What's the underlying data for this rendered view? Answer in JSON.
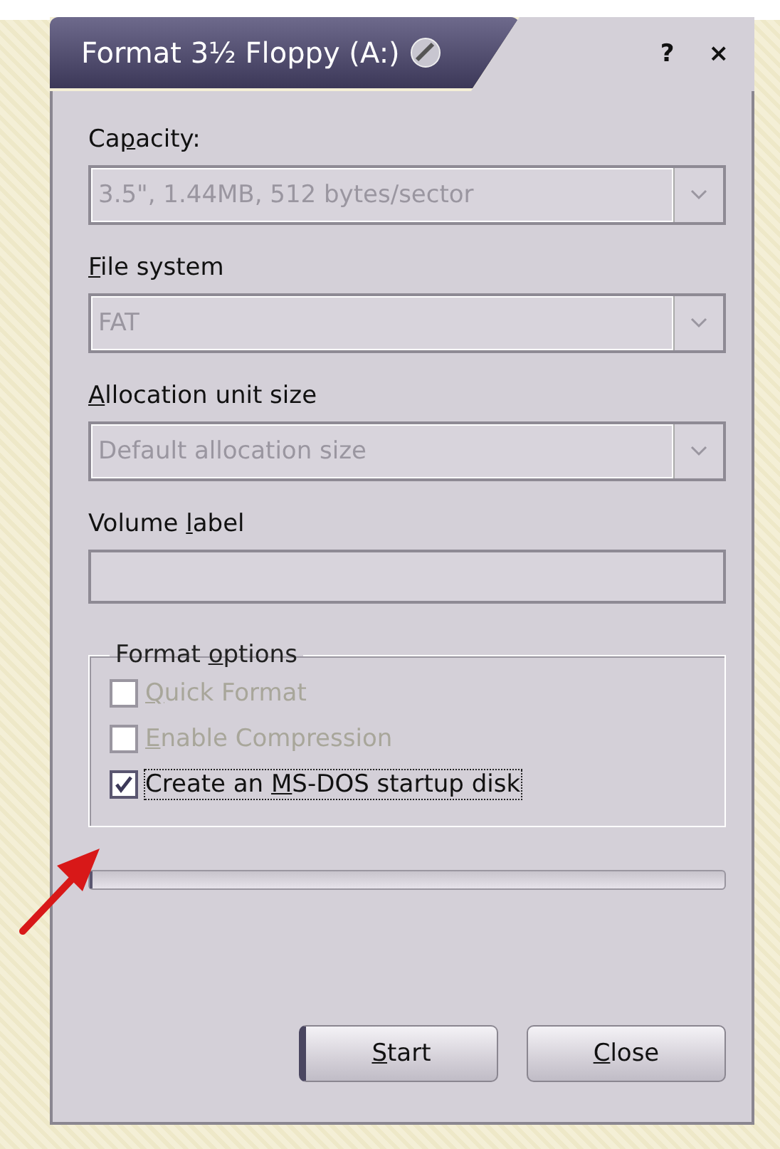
{
  "window": {
    "title": "Format 3½ Floppy (A:)",
    "help": "?",
    "close": "×"
  },
  "fields": [
    {
      "kind": "combo",
      "label": {
        "before": "Ca",
        "key": "p",
        "after": "acity:"
      },
      "value": "3.5\",  1.44MB, 512 bytes/sector",
      "disabled": true
    },
    {
      "kind": "combo",
      "label": {
        "key": "F",
        "after": "ile system"
      },
      "value": "FAT",
      "disabled": true
    },
    {
      "kind": "combo",
      "label": {
        "key": "A",
        "after": "llocation unit size"
      },
      "value": "Default allocation size",
      "disabled": true
    },
    {
      "kind": "text",
      "label": {
        "before": "Volume ",
        "key": "l",
        "after": "abel"
      }
    }
  ],
  "format_options": {
    "title": {
      "before": "Format ",
      "key": "o",
      "after": "ptions"
    },
    "options": [
      {
        "label": {
          "key": "Q",
          "after": "uick Format"
        },
        "checked": false,
        "disabled": true,
        "focused": false
      },
      {
        "label": {
          "key": "E",
          "after": "nable Compression"
        },
        "checked": false,
        "disabled": true,
        "focused": false
      },
      {
        "label": {
          "before": "Create an ",
          "key": "M",
          "after": "S-DOS startup disk"
        },
        "checked": true,
        "disabled": false,
        "focused": true
      }
    ]
  },
  "progress": {
    "level": 0.0
  },
  "buttons": [
    {
      "label": {
        "key": "S",
        "after": "tart"
      },
      "default": true
    },
    {
      "label": {
        "key": "C",
        "after": "lose"
      },
      "default": false
    }
  ],
  "annotation": {
    "kind": "arrow"
  }
}
